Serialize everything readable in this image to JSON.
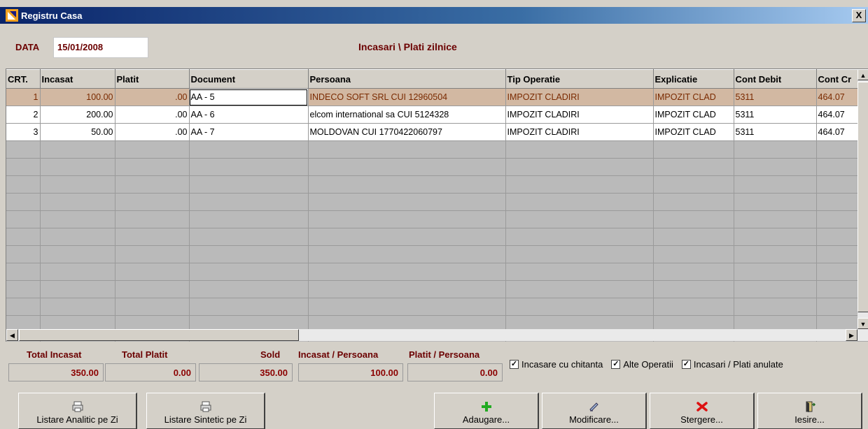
{
  "window": {
    "title": "Registru Casa",
    "close_label": "X"
  },
  "header": {
    "date_label": "DATA",
    "date_value": "15/01/2008",
    "title": "Incasari \\ Plati zilnice"
  },
  "table": {
    "columns": [
      "CRT.",
      "Incasat",
      "Platit",
      "Document",
      "Persoana",
      "Tip Operatie",
      "Explicatie",
      "Cont Debit",
      "Cont Cr"
    ],
    "rows": [
      [
        "1",
        "100.00",
        ".00",
        "AA - 5",
        "INDECO SOFT SRL CUI 12960504",
        "IMPOZIT CLADIRI",
        "IMPOZIT CLAD",
        "5311",
        "464.07"
      ],
      [
        "2",
        "200.00",
        ".00",
        "AA - 6",
        "elcom international sa CUI 5124328",
        "IMPOZIT CLADIRI",
        "IMPOZIT CLAD",
        "5311",
        "464.07"
      ],
      [
        "3",
        "50.00",
        ".00",
        "AA - 7",
        "MOLDOVAN CUI 1770422060797",
        "IMPOZIT CLADIRI",
        "IMPOZIT CLAD",
        "5311",
        "464.07"
      ]
    ]
  },
  "totals": {
    "total_incasat_label": "Total Incasat",
    "total_incasat": "350.00",
    "total_platit_label": "Total Platit",
    "total_platit": "0.00",
    "sold_label": "Sold",
    "sold": "350.00",
    "incasat_persoana_label": "Incasat / Persoana",
    "incasat_persoana": "100.00",
    "platit_persoana_label": "Platit / Persoana",
    "platit_persoana": "0.00"
  },
  "checkboxes": {
    "incasare_chitanta": "Incasare cu chitanta",
    "alte_operatii": "Alte Operatii",
    "anulate": "Incasari / Plati anulate"
  },
  "buttons": {
    "listare_analitic": "Listare Analitic pe Zi",
    "listare_sintetic": "Listare Sintetic pe Zi",
    "adaugare": "Adaugare...",
    "modificare": "Modificare...",
    "stergere": "Stergere...",
    "iesire": "Iesire..."
  },
  "colors": {
    "accent": "#6b0000",
    "selected_row": "#d2b8a2"
  }
}
